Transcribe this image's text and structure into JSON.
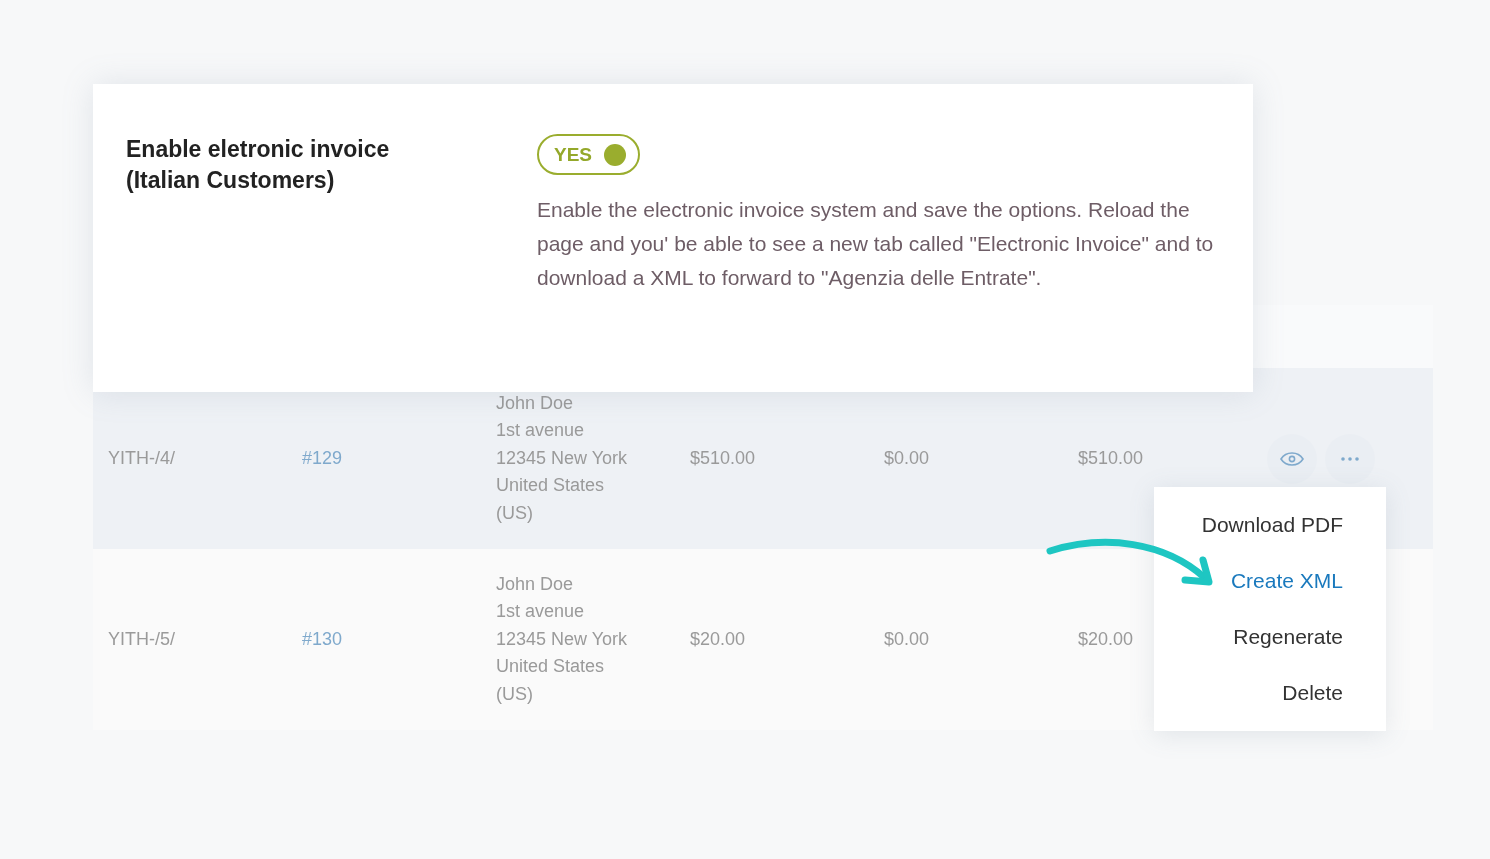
{
  "setting": {
    "label": "Enable eletronic invoice (Italian Customers)",
    "toggle": {
      "label": "YES",
      "on": true
    },
    "description": "Enable the electronic invoice system and save the options. Reload the page and you' be able to see a new tab called \"Electronic Invoice\" and to download a XML to forward to \"Agenzia delle Entrate\"."
  },
  "table": {
    "rows": [
      {
        "selected": true,
        "invoice": "YITH-/4/",
        "order": "#129",
        "address": [
          "John Doe",
          "1st avenue",
          "12345 New York",
          "United States",
          "(US)"
        ],
        "subtotal": "$510.00",
        "tax": "$0.00",
        "total": "$510.00"
      },
      {
        "selected": false,
        "invoice": "YITH-/5/",
        "order": "#130",
        "address": [
          "John Doe",
          "1st avenue",
          "12345 New York",
          "United States",
          "(US)"
        ],
        "subtotal": "$20.00",
        "tax": "$0.00",
        "total": "$20.00"
      }
    ]
  },
  "menu": {
    "items": [
      {
        "label": "Download PDF",
        "selected": false
      },
      {
        "label": "Create XML",
        "selected": true
      },
      {
        "label": "Regenerate",
        "selected": false
      },
      {
        "label": "Delete",
        "selected": false
      }
    ]
  }
}
